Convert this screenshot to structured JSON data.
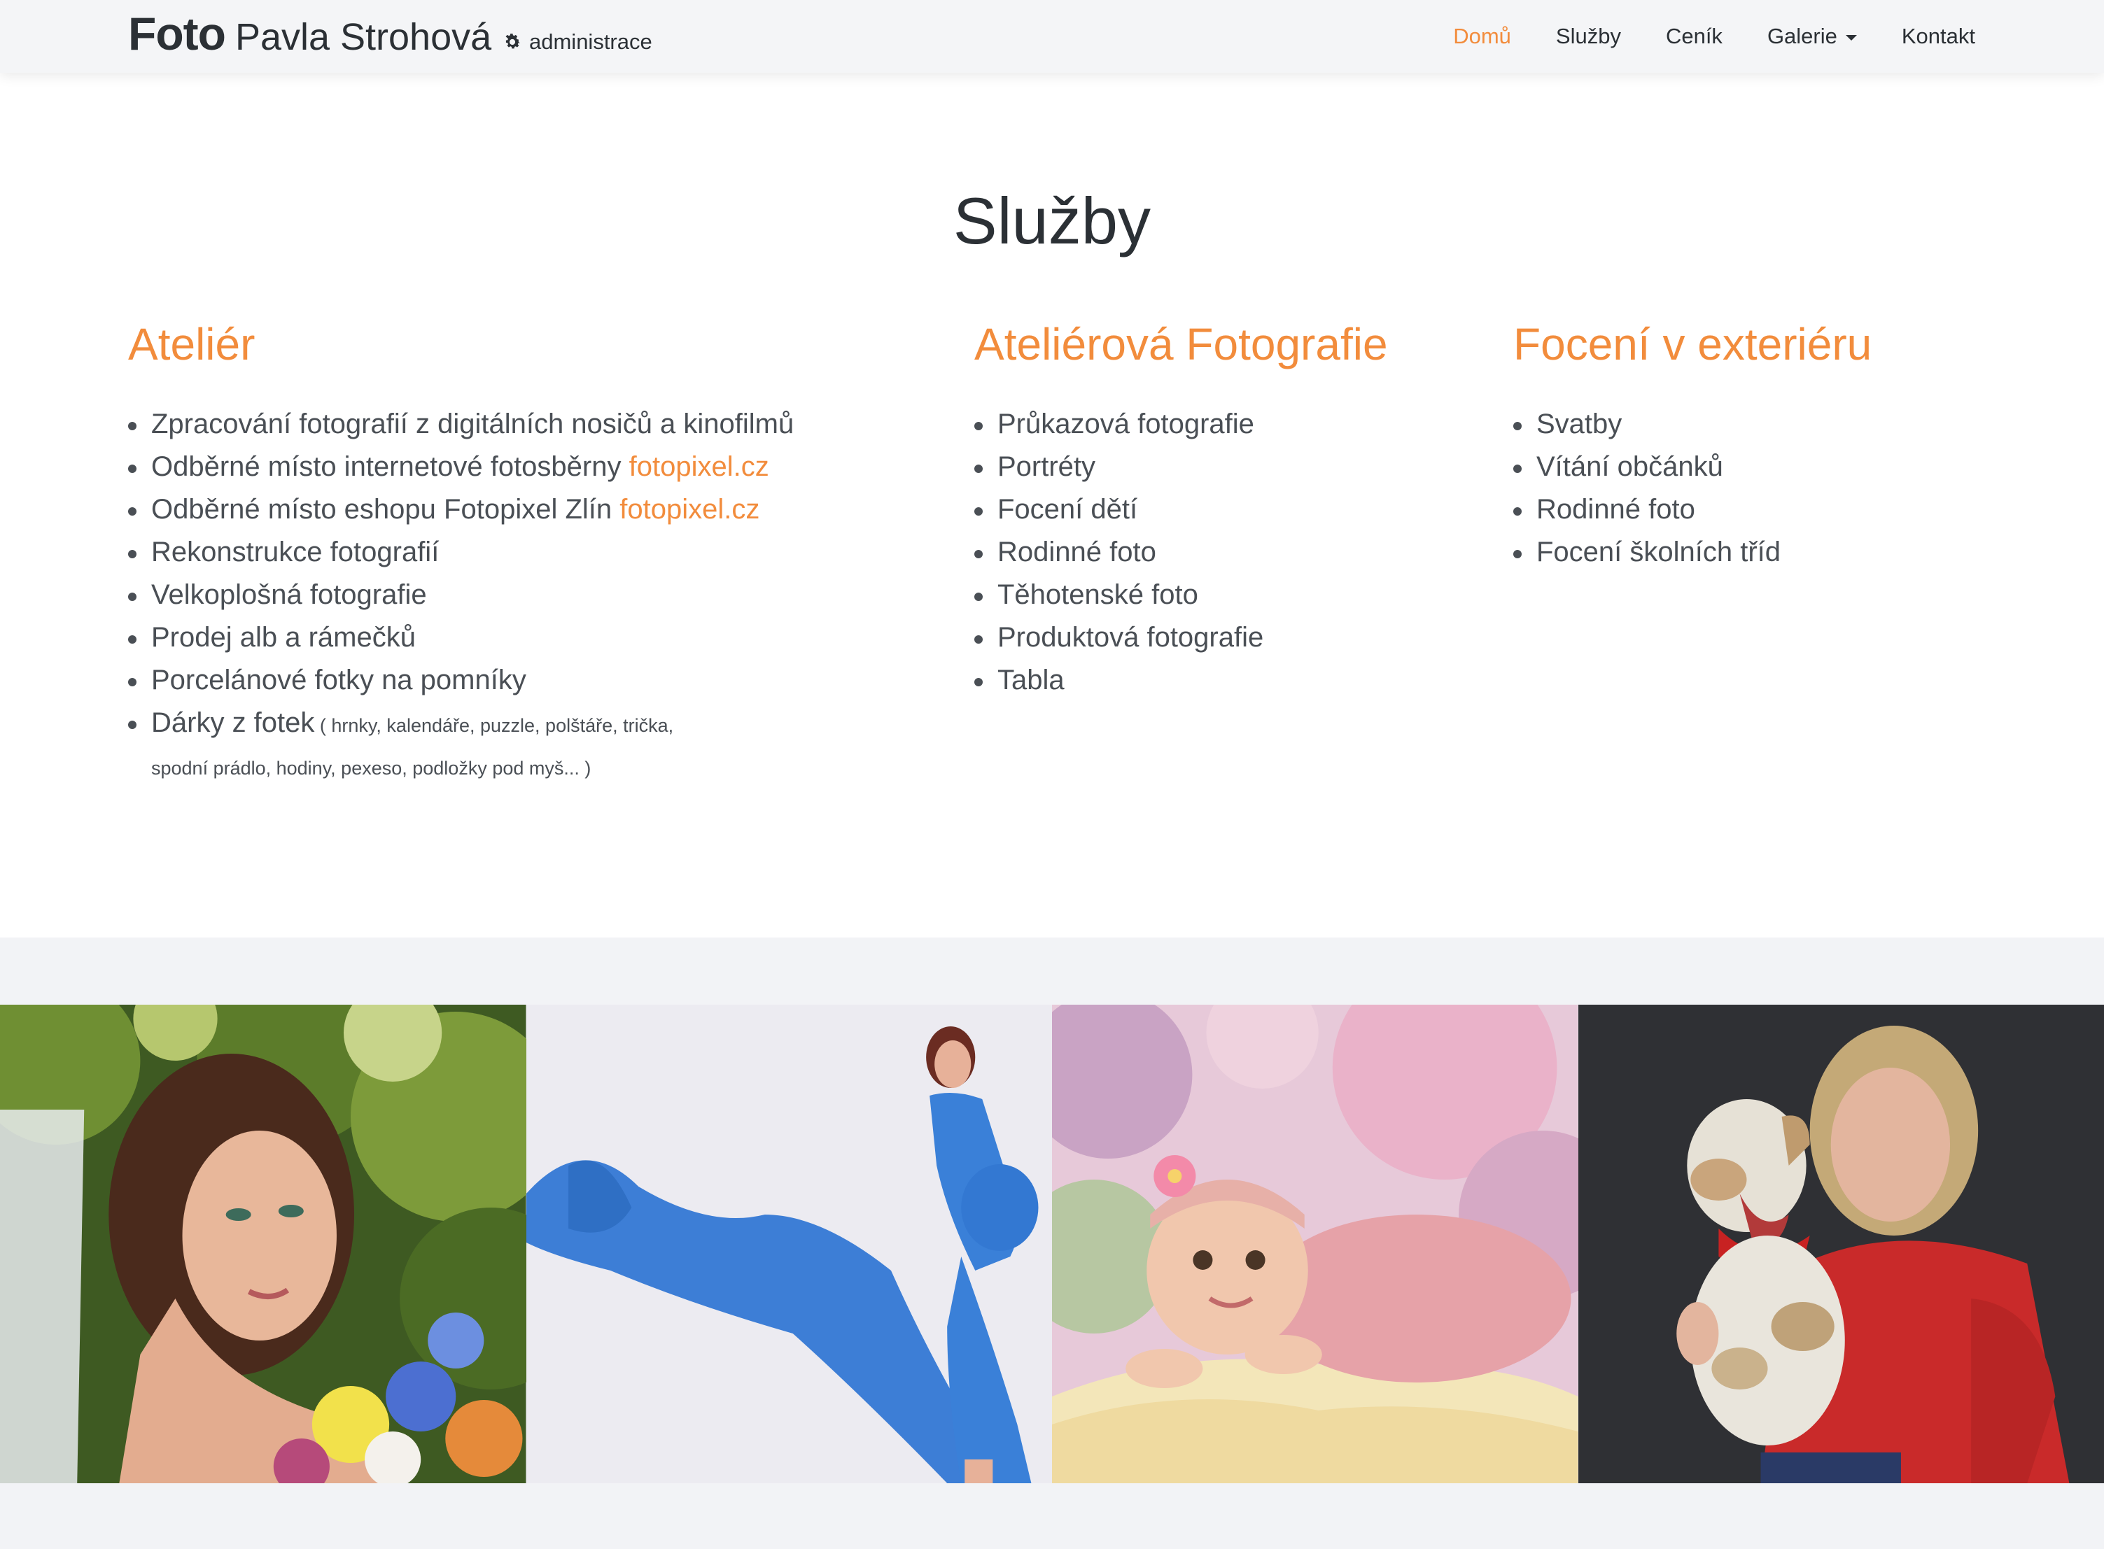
{
  "brand": {
    "bold": "Foto",
    "light": "Pavla Strohová"
  },
  "admin": {
    "label": "administrace",
    "icon": "gear-icon"
  },
  "nav": [
    {
      "label": "Domů",
      "active": true
    },
    {
      "label": "Služby",
      "active": false
    },
    {
      "label": "Ceník",
      "active": false
    },
    {
      "label": "Galerie",
      "active": false,
      "dropdown": true
    },
    {
      "label": "Kontakt",
      "active": false
    }
  ],
  "services": {
    "title": "Služby",
    "columns": [
      {
        "heading": "Ateliér",
        "items": [
          {
            "text": "Zpracování fotografií z digitálních nosičů a kinofilmů"
          },
          {
            "text": "Odběrné místo internetové fotosběrny ",
            "link": "fotopixel.cz"
          },
          {
            "text": "Odběrné místo eshopu Fotopixel Zlín ",
            "link": "fotopixel.cz"
          },
          {
            "text": "Rekonstrukce fotografií"
          },
          {
            "text": "Velkoplošná fotografie"
          },
          {
            "text": "Prodej alb a rámečků"
          },
          {
            "text": "Porcelánové fotky na pomníky"
          },
          {
            "text": "Dárky z fotek",
            "note": " ( hrnky, kalendáře, puzzle, polštáře, trička,",
            "note2": "spodní prádlo, hodiny, pexeso, podložky pod myš... )"
          }
        ]
      },
      {
        "heading": "Ateliérová Fotografie",
        "items": [
          {
            "text": "Průkazová fotografie"
          },
          {
            "text": "Portréty"
          },
          {
            "text": "Focení dětí"
          },
          {
            "text": "Rodinné foto"
          },
          {
            "text": "Těhotenské foto"
          },
          {
            "text": "Produktová fotografie"
          },
          {
            "text": "Tabla"
          }
        ]
      },
      {
        "heading": "Focení v exteriéru",
        "items": [
          {
            "text": "Svatby"
          },
          {
            "text": "Vítání občánků"
          },
          {
            "text": "Rodinné foto"
          },
          {
            "text": "Focení školních tříd"
          }
        ]
      }
    ]
  },
  "colors": {
    "accent": "#f28c3c",
    "text": "#2b3035",
    "navbar": "#f4f5f7",
    "band": "#f2f3f6"
  }
}
